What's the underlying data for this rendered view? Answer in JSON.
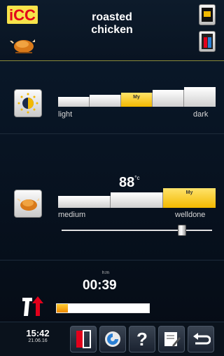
{
  "header": {
    "logo_text": "iCC",
    "title_line1": "roasted",
    "title_line2": "chicken",
    "icons": [
      "icc-logo",
      "chicken-icon",
      "oven-door-icon",
      "core-probe-icon"
    ]
  },
  "browning": {
    "icon": "browning-sun-icon",
    "segments": [
      "",
      "",
      "My",
      "",
      ""
    ],
    "selected_index": 2,
    "label_low": "light",
    "label_high": "dark"
  },
  "doneness": {
    "icon": "roast-chicken-icon",
    "temperature": "88",
    "temp_unit": "°c",
    "segments": [
      "",
      "",
      "My"
    ],
    "selected_index": 2,
    "label_low": "medium",
    "label_high": "welldone",
    "slider_level": 0.82
  },
  "timer": {
    "unit": "h:m",
    "value": "00:39",
    "progress": 0.12,
    "icon": "rising-temperature-icon"
  },
  "footer": {
    "time": "15:42",
    "date": "21.06.16",
    "buttons": [
      "door-icon",
      "cleaning-icon",
      "help-icon",
      "notes-icon",
      "back-icon"
    ],
    "help_label": "?"
  },
  "colors": {
    "accent_yellow": "#f2b900",
    "logo_red": "#e3001b",
    "arrow_red": "#e3001b"
  }
}
